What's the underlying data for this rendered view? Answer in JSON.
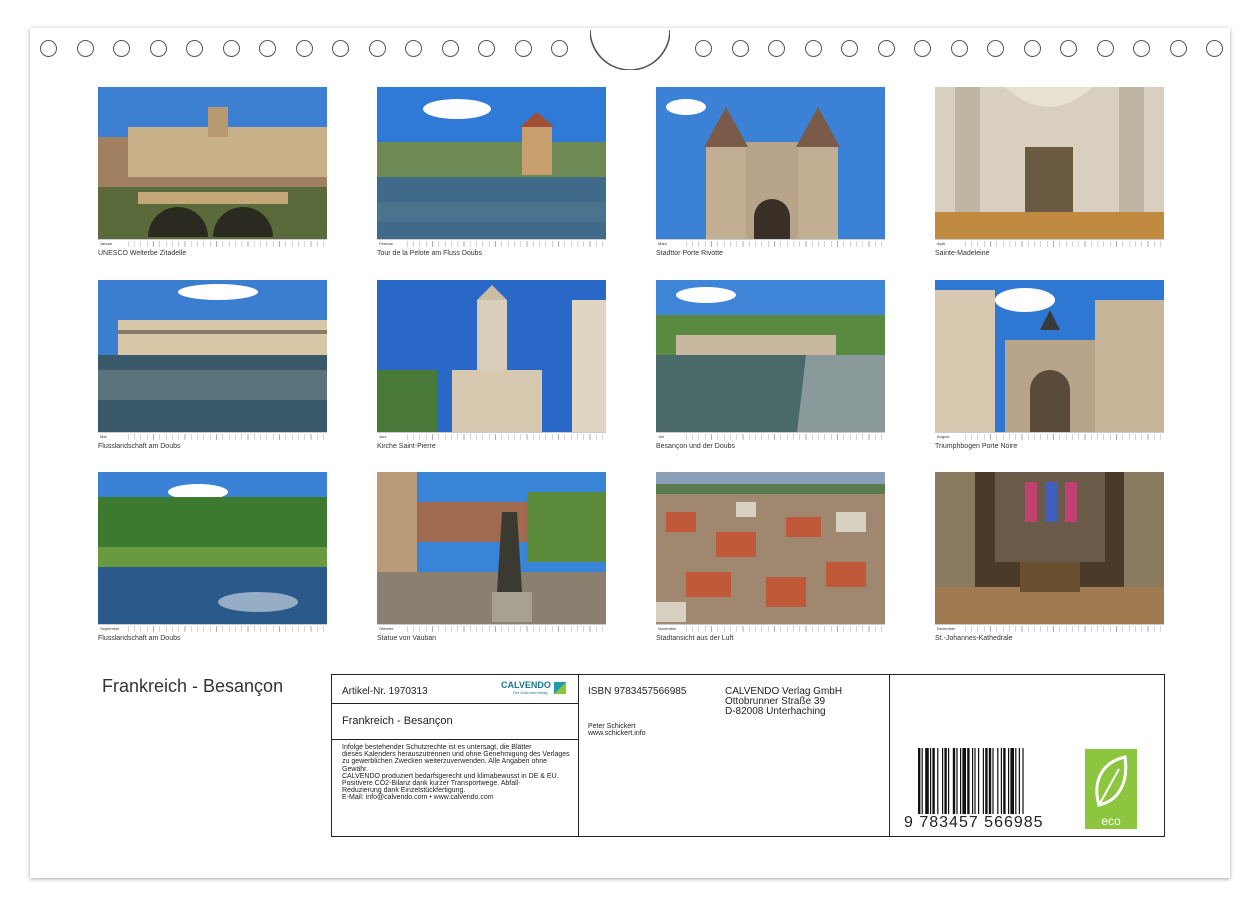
{
  "calendar": {
    "title": "Frankreich - Besançon",
    "photos": [
      {
        "month": "Januar",
        "caption": "UNESCO Welterbe Zitadelle"
      },
      {
        "month": "Februar",
        "caption": "Tour de la Pelote am Fluss Doubs"
      },
      {
        "month": "März",
        "caption": "Stadttor Porte Rivotte"
      },
      {
        "month": "April",
        "caption": "Sainte-Madeleine"
      },
      {
        "month": "Mai",
        "caption": "Flusslandschaft am Doubs"
      },
      {
        "month": "Juni",
        "caption": "Kirche Saint-Pierre"
      },
      {
        "month": "Juli",
        "caption": "Besançon und der Doubs"
      },
      {
        "month": "August",
        "caption": "Triumphbogen Porte Noire"
      },
      {
        "month": "September",
        "caption": "Flusslandschaft am Doubs"
      },
      {
        "month": "Oktober",
        "caption": "Statue von Vauban"
      },
      {
        "month": "November",
        "caption": "Stadtansicht aus der Luft"
      },
      {
        "month": "Dezember",
        "caption": "St.-Johannes-Kathedrale"
      }
    ]
  },
  "info_box": {
    "article": "Artikel-Nr. 1970313",
    "brand": "CALVENDO",
    "brand_sub": "Der Kalenderverlag",
    "title": "Frankreich - Besançon",
    "legal": [
      "Infolge bestehender Schutzrechte ist es untersagt, die Blätter",
      "dieses Kalenders herauszutrennen und ohne Genehmigung des Verlages",
      "zu gewerblichen Zwecken weiterzuverwenden. Alle Angaben ohne",
      "Gewähr.",
      "CALVENDO produziert bedarfsgerecht und klimabewusst in DE & EU.",
      "Positivere CO2-Bilanz dank kurzer Transportwege. Abfall-",
      "Reduzierung dank Einzelstückfertigung.",
      "E-Mail: info@calvendo.com • www.calvendo.com"
    ],
    "isbn": "ISBN 9783457566985",
    "publisher": [
      "CALVENDO Verlag GmbH",
      "Ottobrunner Straße 39",
      "D-82008 Unterhaching"
    ],
    "author": "Peter Schickert",
    "author_url": "www.schickert.info",
    "ean_digits": "9 783457 566985",
    "eco_label": "eco"
  }
}
